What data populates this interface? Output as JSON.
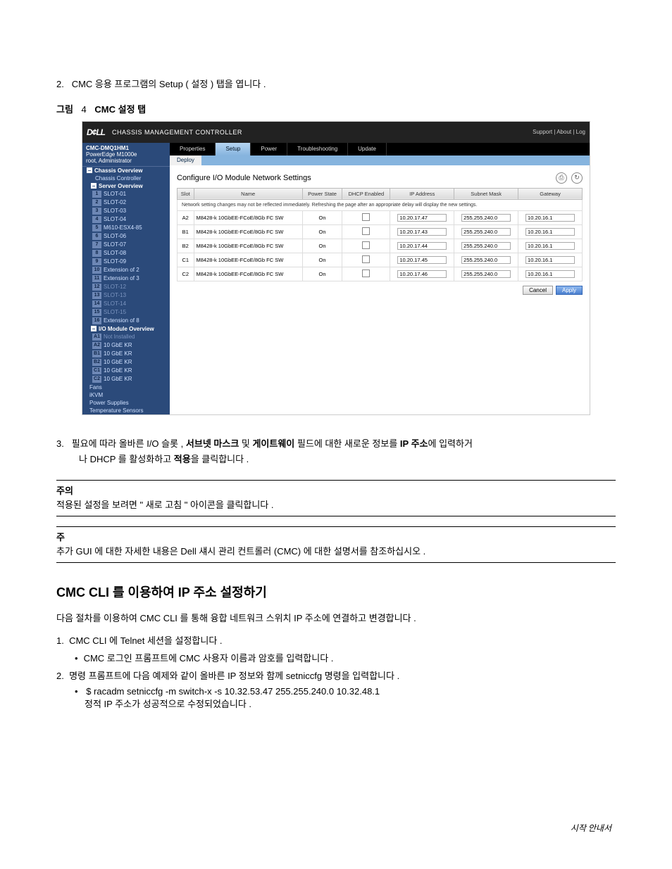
{
  "step2": {
    "number": "2.",
    "text": "CMC 응용 프로그램의 Setup ( 설정 ) 탭을 엽니다 ."
  },
  "figure_caption": {
    "prefix": "그림",
    "num": "4",
    "title": "CMC 설정 탭"
  },
  "cmc": {
    "logo_text": "D¢LL",
    "app_title": "CHASSIS MANAGEMENT CONTROLLER",
    "header_links": "Support  |  About  |  Log",
    "nav_head_line1": "CMC-DMQ1HM1",
    "nav_head_line2": "PowerEdge M1000e",
    "nav_head_line3": "root, Administrator",
    "groups": {
      "chassis": "Chassis Overview",
      "chassis_ctrl": "Chassis Controller",
      "server": "Server Overview",
      "io": "I/O Module Overview"
    },
    "servers": [
      {
        "n": "1",
        "t": "SLOT-01"
      },
      {
        "n": "2",
        "t": "SLOT-02"
      },
      {
        "n": "3",
        "t": "SLOT-03"
      },
      {
        "n": "4",
        "t": "SLOT-04"
      },
      {
        "n": "5",
        "t": "M610-ESX4-85"
      },
      {
        "n": "6",
        "t": "SLOT-06"
      },
      {
        "n": "7",
        "t": "SLOT-07"
      },
      {
        "n": "8",
        "t": "SLOT-08"
      },
      {
        "n": "9",
        "t": "SLOT-09"
      },
      {
        "n": "10",
        "t": "Extension of 2"
      },
      {
        "n": "11",
        "t": "Extension of 3"
      },
      {
        "n": "12",
        "t": "SLOT-12",
        "dim": true
      },
      {
        "n": "13",
        "t": "SLOT-13",
        "dim": true
      },
      {
        "n": "14",
        "t": "SLOT-14",
        "dim": true
      },
      {
        "n": "15",
        "t": "SLOT-15",
        "dim": true
      },
      {
        "n": "16",
        "t": "Extension of 8"
      }
    ],
    "io_items": [
      {
        "n": "A1",
        "t": "Not Installed",
        "dim": true
      },
      {
        "n": "A2",
        "t": "10 GbE KR"
      },
      {
        "n": "B1",
        "t": "10 GbE KR"
      },
      {
        "n": "B2",
        "t": "10 GbE KR"
      },
      {
        "n": "C1",
        "t": "10 GbE KR"
      },
      {
        "n": "C2",
        "t": "10 GbE KR"
      }
    ],
    "nav_tail": [
      "Fans",
      "iKVM",
      "Power Supplies",
      "Temperature Sensors"
    ],
    "tabs": [
      "Properties",
      "Setup",
      "Power",
      "Troubleshooting",
      "Update"
    ],
    "subtab": "Deploy",
    "panel_title": "Configure I/O Module Network Settings",
    "table_headers": [
      "Slot",
      "Name",
      "Power State",
      "DHCP Enabled",
      "IP Address",
      "Subnet Mask",
      "Gateway"
    ],
    "note_row": "Network setting changes may not be reflected immediately. Refreshing the page after an appropriate delay will display the new settings.",
    "rows": [
      {
        "slot": "A2",
        "name": "M8428-k 10GbEE-FCoE/8Gb FC SW",
        "power": "On",
        "ip": "10.20.17.47",
        "mask": "255.255.240.0",
        "gw": "10.20.16.1"
      },
      {
        "slot": "B1",
        "name": "M8428-k 10GbEE-FCoE/8Gb FC SW",
        "power": "On",
        "ip": "10.20.17.43",
        "mask": "255.255.240.0",
        "gw": "10.20.16.1"
      },
      {
        "slot": "B2",
        "name": "M8428-k 10GbEE-FCoE/8Gb FC SW",
        "power": "On",
        "ip": "10.20.17.44",
        "mask": "255.255.240.0",
        "gw": "10.20.16.1"
      },
      {
        "slot": "C1",
        "name": "M8428-k 10GbEE-FCoE/8Gb FC SW",
        "power": "On",
        "ip": "10.20.17.45",
        "mask": "255.255.240.0",
        "gw": "10.20.16.1"
      },
      {
        "slot": "C2",
        "name": "M8428-k 10GbEE-FCoE/8Gb FC SW",
        "power": "On",
        "ip": "10.20.17.46",
        "mask": "255.255.240.0",
        "gw": "10.20.16.1"
      }
    ],
    "cancel": "Cancel",
    "apply": "Apply"
  },
  "step3": {
    "number": "3.",
    "line1": "필요에 따라 올바른 I/O 슬롯 , 서브넷 마스크 및 게이트웨이 필드에 대한 새로운 정보를 IP 주소에 입력하거나 DHCP 를 활성화하고 적용을 클릭합니다 .",
    "bold_slot": "서브넷 마스크",
    "bold_gw": "게이트웨이",
    "bold_ip": "IP 주소",
    "bold_apply": "적용"
  },
  "note1": {
    "head": "주의",
    "body": "적용된 설정을 보려면 \" 새로 고침 \" 아이콘을 클릭합니다 ."
  },
  "note2": {
    "head": "주",
    "body": "추가 GUI 에 대한 자세한 내용은 Dell 섀시 관리 컨트롤러 (CMC) 에 대한 설명서를 참조하십시오 ."
  },
  "section_heading": "CMC CLI 를 이용하여 IP 주소 설정하기",
  "para_intro": "다음 절차를 이용하여 CMC CLI 를 통해 융합 네트워크 스위치 IP 주소에 연결하고 변경합니다 .",
  "cli_steps": {
    "s1": "CMC CLI 에 Telnet 세션을 설정합니다 .",
    "s1b": "CMC 로그인 프롬프트에 CMC 사용자 이름과 암호를 입력합니다 .",
    "s2": "명령 프롬프트에 다음 예제와 같이 올바른 IP 정보와 함께 setniccfg 명령을 입력합니다 .",
    "s2b1": "$ racadm setniccfg -m switch-x -s 10.32.53.47 255.255.240.0 10.32.48.1",
    "s2b2": "정적 IP 주소가 성공적으로 수정되었습니다 ."
  },
  "footer": "시작 안내서"
}
